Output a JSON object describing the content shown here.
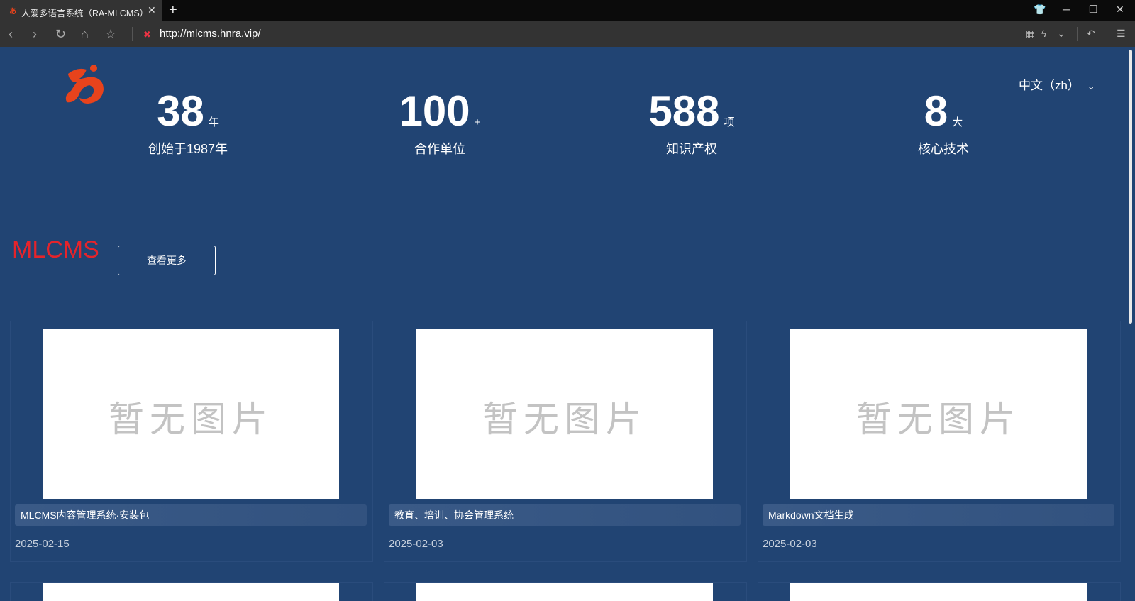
{
  "browser": {
    "tab_title": "人爱多语言系统（RA-MLCMS）",
    "url": "http://mlcms.hnra.vip/"
  },
  "page": {
    "language": "中文（zh）",
    "stats": [
      {
        "number": "38",
        "unit": "年",
        "label": "创始于1987年"
      },
      {
        "number": "100",
        "unit": "+",
        "label": "合作单位"
      },
      {
        "number": "588",
        "unit": "项",
        "label": "知识产权"
      },
      {
        "number": "8",
        "unit": "大",
        "label": "核心技术"
      }
    ],
    "section": {
      "title": "MLCMS",
      "more_label": "查看更多"
    },
    "cards": [
      {
        "image_text": "暂无图片",
        "title": "MLCMS内容管理系统·安装包",
        "date": "2025-02-15"
      },
      {
        "image_text": "暂无图片",
        "title": "教育、培训、协会管理系统",
        "date": "2025-02-03"
      },
      {
        "image_text": "暂无图片",
        "title": "Markdown文档生成",
        "date": "2025-02-03"
      }
    ],
    "colors": {
      "background": "#214473",
      "section_title": "#e5242b",
      "logo": "#e8431c"
    }
  }
}
